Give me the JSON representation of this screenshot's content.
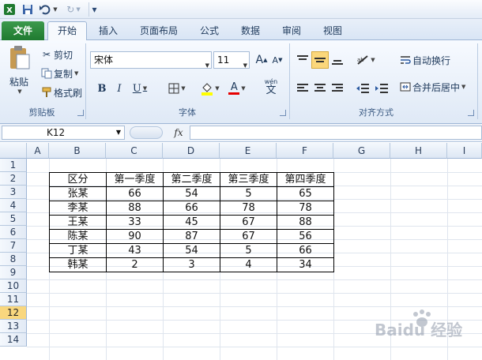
{
  "qat": {
    "redo_symbol": "↻",
    "customize_symbol": "▾"
  },
  "tabs": [
    "文件",
    "开始",
    "插入",
    "页面布局",
    "公式",
    "数据",
    "审阅",
    "视图"
  ],
  "clipboard": {
    "paste": "粘贴",
    "cut": "剪切",
    "copy": "复制",
    "format_painter": "格式刷",
    "group_label": "剪贴板"
  },
  "font": {
    "name": "宋体",
    "size": "11",
    "bold": "B",
    "italic": "I",
    "underline": "U",
    "grow": "A",
    "shrink": "A",
    "font_color": "A",
    "phonetic": "wén",
    "group_label": "字体"
  },
  "alignment": {
    "wrap_text": "自动换行",
    "merge_center": "合并后居中",
    "group_label": "对齐方式"
  },
  "formula_bar": {
    "name_box": "K12",
    "fx": "fx",
    "value": ""
  },
  "grid": {
    "columns": [
      "A",
      "B",
      "C",
      "D",
      "E",
      "F",
      "G",
      "H",
      "I"
    ],
    "rows": [
      "1",
      "2",
      "3",
      "4",
      "5",
      "6",
      "7",
      "8",
      "9",
      "10",
      "11",
      "12",
      "13",
      "14"
    ],
    "active_row": "12",
    "table": [
      [
        "区分",
        "第一季度",
        "第二季度",
        "第三季度",
        "第四季度"
      ],
      [
        "张某",
        "66",
        "54",
        "5",
        "65"
      ],
      [
        "李某",
        "88",
        "66",
        "78",
        "78"
      ],
      [
        "王某",
        "33",
        "45",
        "67",
        "88"
      ],
      [
        "陈某",
        "90",
        "87",
        "67",
        "56"
      ],
      [
        "丁某",
        "43",
        "54",
        "5",
        "66"
      ],
      [
        "韩某",
        "2",
        "3",
        "4",
        "34"
      ]
    ]
  },
  "colors": {
    "file_tab": "#2a8a3c",
    "active_row_header": "#f9d77e",
    "highlight_yellow": "#ffff00",
    "font_red": "#e60000"
  },
  "watermark": "Baidu 经验"
}
